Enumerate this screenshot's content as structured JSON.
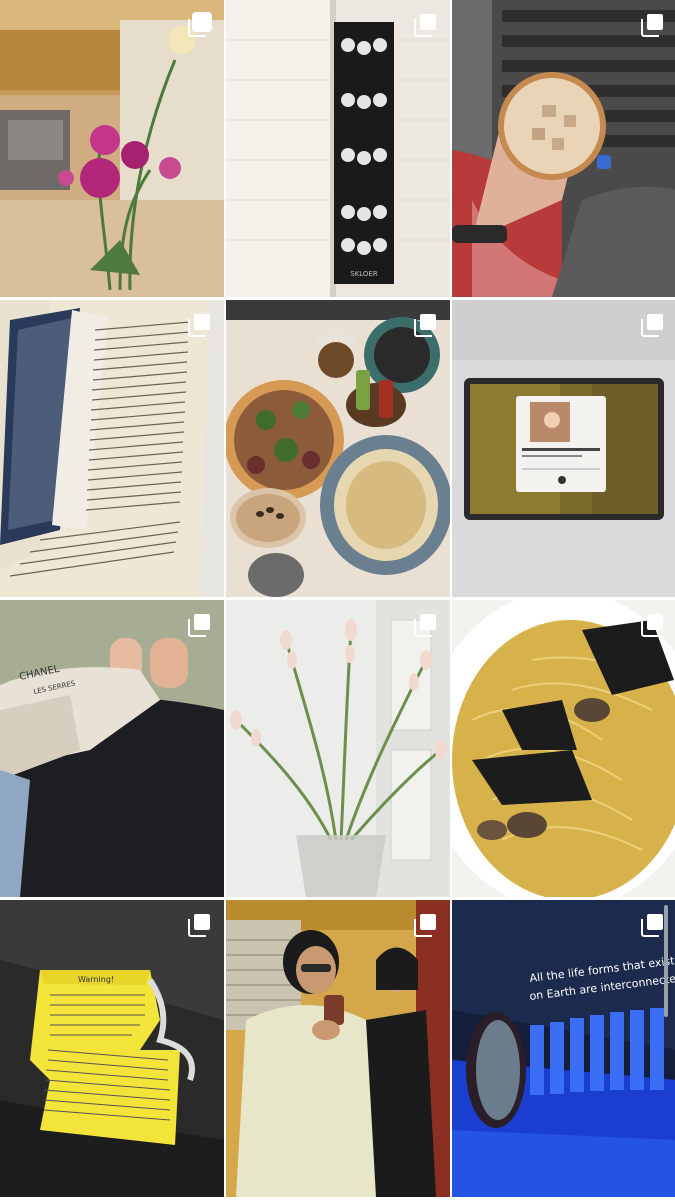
{
  "grid": {
    "columns": 3,
    "posts": [
      {
        "subject": "pink flowers in a vase at a cafe counter",
        "multi_photo": true
      },
      {
        "subject": "black and white photo booth strip in a notebook",
        "multi_photo": true,
        "strip_caption": "SKLOER"
      },
      {
        "subject": "iced latte held up over an escalator",
        "multi_photo": true
      },
      {
        "subject": "open paperback book",
        "multi_photo": true
      },
      {
        "subject": "pizza, pasta and espresso martini on a table",
        "multi_photo": true
      },
      {
        "subject": "tablet playing music on a white desk",
        "multi_photo": true
      },
      {
        "subject": "legs with a canvas tote bag",
        "multi_photo": true,
        "bag_text": "CHANEL",
        "bag_subtext": "LES SERRES"
      },
      {
        "subject": "tuberose stems in a glass vase",
        "multi_photo": true
      },
      {
        "subject": "pasta with squid ink crisps and mushrooms",
        "multi_photo": true
      },
      {
        "subject": "yellow warning label peeling",
        "multi_photo": true,
        "label_title": "Warning!"
      },
      {
        "subject": "two women taking a mirror selfie",
        "multi_photo": true
      },
      {
        "subject": "blue lit exhibition wall with round window",
        "multi_photo": true,
        "wall_text_line1": "All the life forms that exist",
        "wall_text_line2": "on Earth are interconnected"
      }
    ]
  },
  "icons": {
    "multi_photo": "carousel-stack-icon"
  },
  "colors": {
    "background": "#ffffff",
    "icon": "#ffffff"
  }
}
